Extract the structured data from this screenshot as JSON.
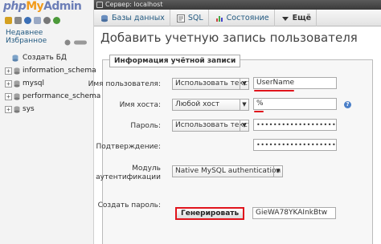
{
  "logo": {
    "php": "php",
    "my": "My",
    "admin": "Admin"
  },
  "sidebar": {
    "tab_recent": "Недавнее",
    "tab_favorites": "Избранное",
    "create_db": "Создать БД",
    "databases": [
      "information_schema",
      "mysql",
      "performance_schema",
      "sys"
    ]
  },
  "serverbar": {
    "text": "Сервер: localhost"
  },
  "tabs": [
    {
      "label": "Базы данных",
      "icon": "database-icon"
    },
    {
      "label": "SQL",
      "icon": "sql-icon"
    },
    {
      "label": "Состояние",
      "icon": "status-icon"
    },
    {
      "label": "Ещё",
      "icon": "chevron-down-icon"
    }
  ],
  "page": {
    "title": "Добавить учетную запись пользователя"
  },
  "form": {
    "legend": "Информация учётной записи",
    "username_label": "Имя пользователя:",
    "username_mode": "Использовать текстовое поле",
    "username_value": "UserName",
    "host_label": "Имя хоста:",
    "host_mode": "Любой хост",
    "host_value": "%",
    "password_label": "Пароль:",
    "password_mode": "Использовать текстовое поле",
    "password_value": "••••••••••••••••••••••••",
    "confirm_label": "Подтверждение:",
    "confirm_value": "••••••••••••••••••••••••",
    "auth_label": "Модуль аутентификации",
    "auth_value": "Native MySQL authentication",
    "generate_label": "Создать пароль:",
    "generate_button": "Генерировать",
    "generated_value": "GieWA78YKAInkBtw"
  },
  "colors": {
    "accent_red": "#e0141c",
    "link_blue": "#235a81"
  }
}
